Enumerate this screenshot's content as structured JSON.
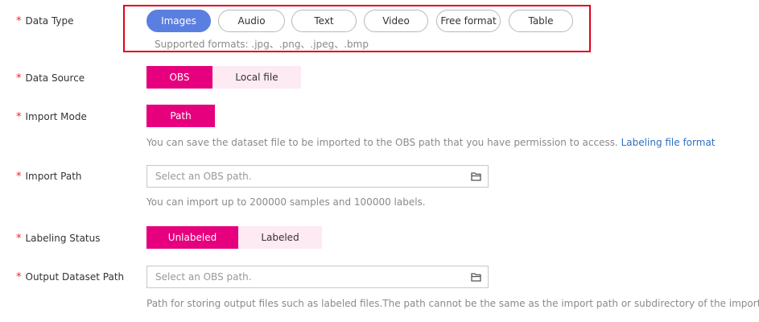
{
  "data_type": {
    "label": "Data Type",
    "options": [
      "Images",
      "Audio",
      "Text",
      "Video",
      "Free format",
      "Table"
    ],
    "selected": "Images",
    "hint": "Supported formats: .jpg、.png、.jpeg、.bmp"
  },
  "data_source": {
    "label": "Data Source",
    "options": [
      "OBS",
      "Local file"
    ],
    "selected": "OBS"
  },
  "import_mode": {
    "label": "Import Mode",
    "options": [
      "Path"
    ],
    "selected": "Path",
    "hint": "You can save the dataset file to be imported to the OBS path that you have permission to access.",
    "link": "Labeling file format"
  },
  "import_path": {
    "label": "Import Path",
    "placeholder": "Select an OBS path.",
    "value": "",
    "hint": "You can import up to 200000 samples and 100000 labels."
  },
  "labeling_status": {
    "label": "Labeling Status",
    "options": [
      "Unlabeled",
      "Labeled"
    ],
    "selected": "Unlabeled"
  },
  "output_path": {
    "label": "Output Dataset Path",
    "placeholder": "Select an OBS path.",
    "value": "",
    "hint": "Path for storing output files such as labeled files.The path cannot be the same as the import path or subdirectory of the import path."
  },
  "required_mark": "*",
  "colors": {
    "accent_blue": "#5b7fe1",
    "accent_pink": "#e6007e",
    "pink_light": "#fdeaf3",
    "highlight_red": "#e3001b",
    "link": "#2e6fbf"
  }
}
